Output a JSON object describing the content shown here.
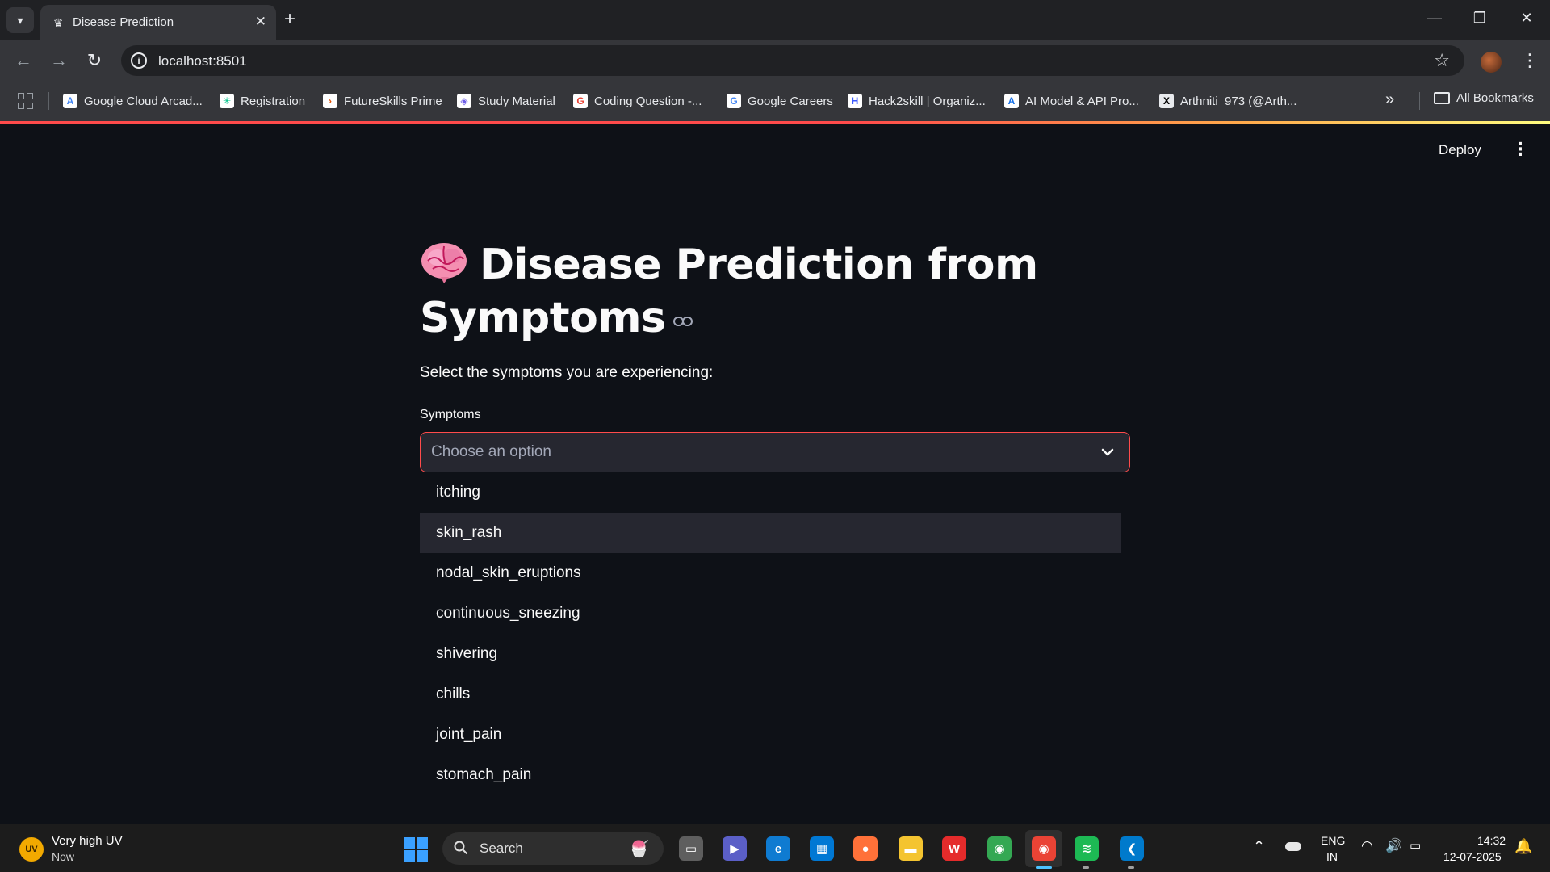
{
  "browser": {
    "tab_title": "Disease Prediction",
    "tab_close": "✕",
    "new_tab": "+",
    "url": "localhost:8501",
    "bookmarks": [
      {
        "label": "Google Cloud Arcad...",
        "icon": "google-cloud-arcade-icon",
        "glyph": "A",
        "color": "#4285f4"
      },
      {
        "label": "Registration",
        "icon": "registration-icon",
        "glyph": "✳",
        "color": "#00c389"
      },
      {
        "label": "FutureSkills Prime",
        "icon": "futureskills-icon",
        "glyph": "›",
        "color": "#e35205"
      },
      {
        "label": "Study Material",
        "icon": "study-material-icon",
        "glyph": "◈",
        "color": "#6c5ce7"
      },
      {
        "label": "Coding Question -...",
        "icon": "google-icon",
        "glyph": "G",
        "color": "#ea4335"
      },
      {
        "label": "Google Careers",
        "icon": "google-icon",
        "glyph": "G",
        "color": "#4285f4"
      },
      {
        "label": "Hack2skill | Organiz...",
        "icon": "hack2skill-icon",
        "glyph": "H",
        "color": "#3d5afe"
      },
      {
        "label": "AI Model & API Pro...",
        "icon": "ai-model-icon",
        "glyph": "A",
        "color": "#1a73e8"
      },
      {
        "label": "Arthniti_973 (@Arth...",
        "icon": "x-icon",
        "glyph": "X",
        "color": "#000000"
      }
    ],
    "overflow": "»",
    "all_bookmarks": "All Bookmarks"
  },
  "app": {
    "deploy_label": "Deploy",
    "menu_glyph": "⋮",
    "title": "Disease Prediction from Symptoms",
    "subtitle": "Select the symptoms you are experiencing:",
    "select_label": "Symptoms",
    "select_placeholder": "Choose an option",
    "options": [
      "itching",
      "skin_rash",
      "nodal_skin_eruptions",
      "continuous_sneezing",
      "shivering",
      "chills",
      "joint_pain",
      "stomach_pain"
    ],
    "highlighted_option": "skin_rash",
    "accent_color": "#ff4b4b"
  },
  "taskbar": {
    "weather_badge": "UV",
    "weather_title": "Very high UV",
    "weather_sub": "Now",
    "search_label": "Search",
    "apps": [
      {
        "name": "task-view-icon",
        "glyph": "▭",
        "color": "#5e5e5e"
      },
      {
        "name": "teams-meet-icon",
        "glyph": "▶",
        "color": "#5b5fc7"
      },
      {
        "name": "edge-icon",
        "glyph": "e",
        "color": "#0f7bd1"
      },
      {
        "name": "store-icon",
        "glyph": "▦",
        "color": "#0078d4"
      },
      {
        "name": "firefox-icon",
        "glyph": "●",
        "color": "#ff7139"
      },
      {
        "name": "file-explorer-icon",
        "glyph": "▬",
        "color": "#f4c430"
      },
      {
        "name": "wps-office-icon",
        "glyph": "W",
        "color": "#e52b2b"
      },
      {
        "name": "chrome-icon",
        "glyph": "◉",
        "color": "#34a853"
      },
      {
        "name": "chrome-profile-icon",
        "glyph": "◉",
        "color": "#ea4335"
      },
      {
        "name": "spotify-icon",
        "glyph": "≋",
        "color": "#1db954"
      },
      {
        "name": "vscode-icon",
        "glyph": "❮",
        "color": "#007acc"
      }
    ],
    "lang_top": "ENG",
    "lang_bottom": "IN",
    "time": "14:32",
    "date": "12-07-2025"
  }
}
